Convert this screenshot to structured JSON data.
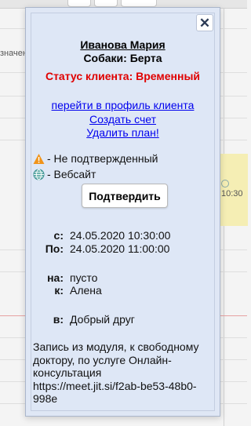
{
  "background": {
    "left_fragment": "значен",
    "event_time": "10:30"
  },
  "popup": {
    "close_symbol": "✕",
    "client_name": "Иванова Мария",
    "pet_line": "Собаки: Берта",
    "status": "Статус клиента: Временный",
    "links": {
      "profile": "перейти в профиль клиента",
      "invoice": "Создать счет",
      "delete_plan": "Удалить план!"
    },
    "legend": {
      "unconfirmed": "- Не подтвержденный",
      "website": "- Вебсайт"
    },
    "confirm_label": "Подтвердить",
    "schedule": {
      "from_label": "с:",
      "from_value": "24.05.2020 10:30:00",
      "to_label": "По:",
      "to_value": "24.05.2020 11:00:00"
    },
    "details": {
      "on_label": "на:",
      "on_value": "пусто",
      "to_label": "к:",
      "to_value": "Алена",
      "in_label": "в:",
      "in_value": "Добрый друг"
    },
    "note": "Запись из модуля, к свободному доктору, по услуге Онлайн-консультация https://meet.jit.si/f2ab-be53-48b0-998e"
  },
  "colors": {
    "status_red": "#e00000",
    "link_blue": "#0000ee",
    "popup_bg": "#dfe7f5",
    "warning_orange": "#f0941a",
    "globe_teal": "#2f8a8a"
  },
  "icons": {
    "warning": "warning-triangle-icon",
    "website": "globe-icon",
    "close": "close-icon"
  }
}
